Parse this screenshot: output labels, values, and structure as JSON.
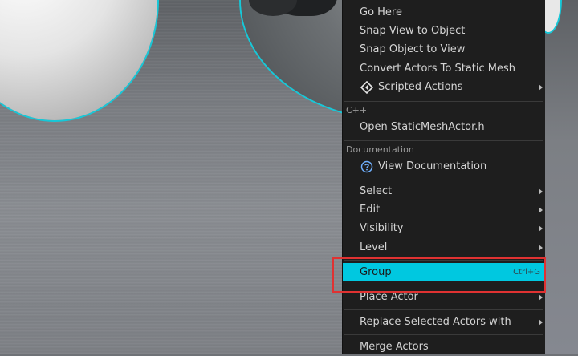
{
  "menu": {
    "top_items": [
      {
        "label": "Go Here"
      },
      {
        "label": "Snap View to Object"
      },
      {
        "label": "Snap Object to View"
      },
      {
        "label": "Convert Actors To Static Mesh"
      },
      {
        "label": "Scripted Actions",
        "icon": "scripted-actions-icon",
        "submenu": true
      }
    ],
    "cpp": {
      "heading": "C++",
      "item": "Open StaticMeshActor.h"
    },
    "documentation": {
      "heading": "Documentation",
      "item": "View Documentation",
      "icon": "help-icon"
    },
    "submenus": [
      {
        "label": "Select"
      },
      {
        "label": "Edit"
      },
      {
        "label": "Visibility"
      },
      {
        "label": "Level"
      }
    ],
    "group": {
      "label": "Group",
      "shortcut": "Ctrl+G"
    },
    "bottom_items": [
      {
        "label": "Place Actor",
        "submenu": true
      },
      {
        "label": "Replace Selected Actors with",
        "submenu": true
      },
      {
        "label": "Merge Actors",
        "submenu": false
      }
    ]
  },
  "colors": {
    "selection": "#00c8e0",
    "highlight_box": "#e03232",
    "outline": "#16c8d8",
    "menu_bg": "#1e1e1e"
  }
}
